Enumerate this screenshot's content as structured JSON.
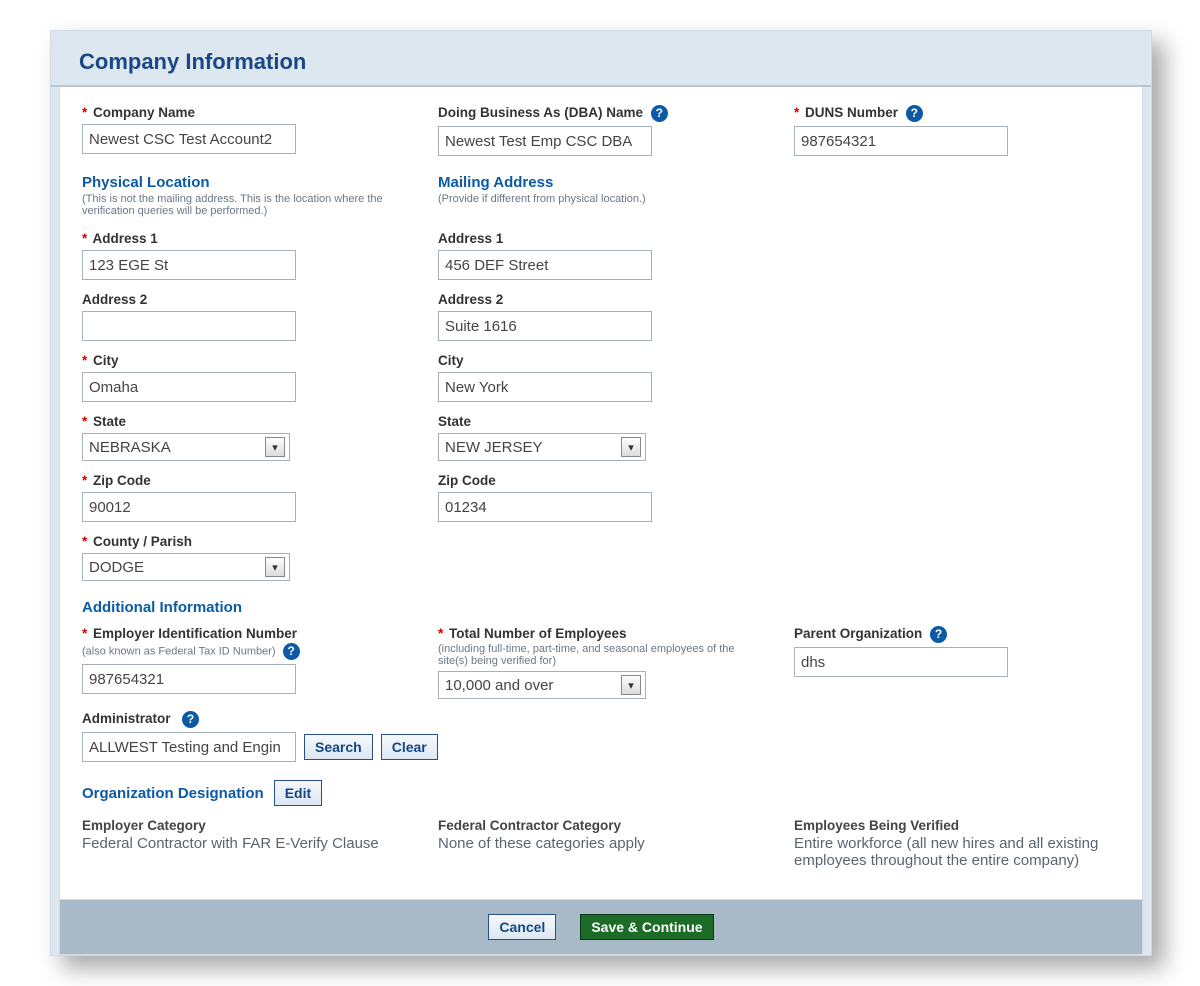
{
  "header": {
    "title": "Company Information"
  },
  "labels": {
    "company_name": "Company Name",
    "dba_name": "Doing Business As (DBA) Name",
    "duns_number": "DUNS Number",
    "phys_loc_title": "Physical Location",
    "phys_loc_sub": "(This is not the mailing address. This is the location where the verification queries will be performed.)",
    "mail_title": "Mailing Address",
    "mail_sub": "(Provide if different from physical location.)",
    "address1": "Address 1",
    "address2": "Address 2",
    "city": "City",
    "state": "State",
    "zip": "Zip Code",
    "county": "County / Parish",
    "additional_info": "Additional Information",
    "ein": "Employer Identification Number",
    "ein_sub": "(also known as Federal Tax ID Number)",
    "total_emp": "Total Number of Employees",
    "total_emp_sub": "(including full-time, part-time, and seasonal employees of the site(s) being verified for)",
    "parent_org": "Parent Organization",
    "administrator": "Administrator",
    "search": "Search",
    "clear": "Clear",
    "org_des": "Organization Designation",
    "edit": "Edit",
    "emp_cat": "Employer Category",
    "fed_cat": "Federal Contractor Category",
    "emp_ver": "Employees Being Verified",
    "cancel": "Cancel",
    "save": "Save & Continue"
  },
  "values": {
    "company_name": "Newest CSC Test Account2",
    "dba_name": "Newest Test Emp CSC DBA",
    "duns_number": "987654321",
    "phys_addr1": "123 EGE St",
    "phys_addr2": "",
    "phys_city": "Omaha",
    "phys_state": "NEBRASKA",
    "phys_zip": "90012",
    "phys_county": "DODGE",
    "mail_addr1": "456 DEF Street",
    "mail_addr2": "Suite 1616",
    "mail_city": "New York",
    "mail_state": "NEW JERSEY",
    "mail_zip": "01234",
    "ein": "987654321",
    "total_emp": "10,000 and over",
    "parent_org": "dhs",
    "administrator": "ALLWEST Testing and Engin",
    "emp_cat": "Federal Contractor with FAR E-Verify Clause",
    "fed_cat": "None of these categories apply",
    "emp_ver": "Entire workforce (all new hires and all existing employees throughout the entire company)"
  }
}
